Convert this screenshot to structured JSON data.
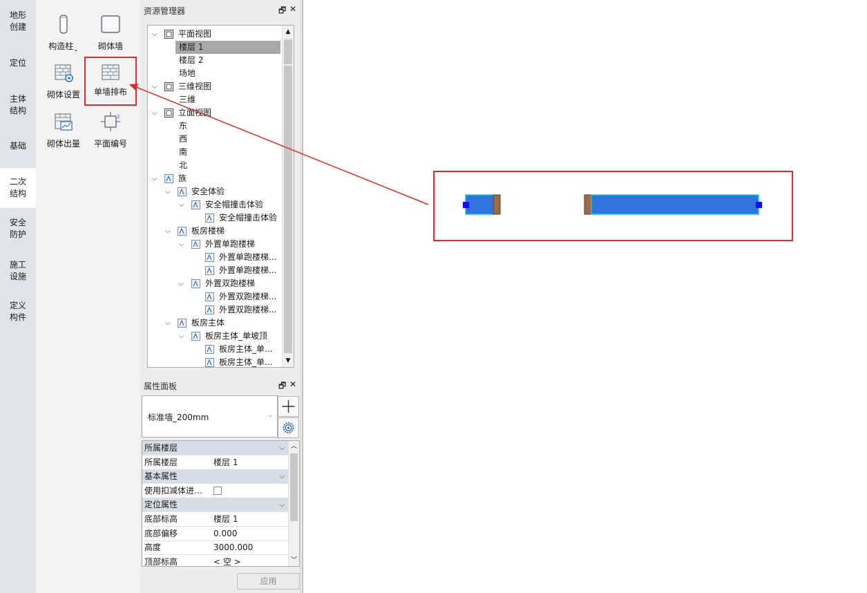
{
  "categories": [
    {
      "label": "地形\n创建",
      "active": false
    },
    {
      "label": "定位",
      "active": false
    },
    {
      "label": "主体\n结构",
      "active": false
    },
    {
      "label": "基础",
      "active": false
    },
    {
      "label": "二次\n结构",
      "active": true
    },
    {
      "label": "安全\n防护",
      "active": false
    },
    {
      "label": "施工\n设施",
      "active": false
    },
    {
      "label": "定义\n构件",
      "active": false
    }
  ],
  "tools": [
    {
      "label": "构造柱",
      "icon": "column-icon",
      "has_dropdown": true
    },
    {
      "label": "砌体墙",
      "icon": "wall-icon"
    },
    {
      "label": "砌体设置",
      "icon": "masonry-settings-icon"
    },
    {
      "label": "单墙排布",
      "icon": "single-wall-layout-icon",
      "highlighted": true
    },
    {
      "label": "砌体出量",
      "icon": "masonry-quantity-icon"
    },
    {
      "label": "平面编号",
      "icon": "plan-numbering-icon"
    }
  ],
  "resource_manager": {
    "title": "资源管理器",
    "tree": [
      {
        "label": "平面视图",
        "level": 0,
        "expanded": true,
        "icon": "plan-view-icon"
      },
      {
        "label": "楼层 1",
        "level": 1,
        "selected": true
      },
      {
        "label": "楼层 2",
        "level": 1
      },
      {
        "label": "场地",
        "level": 1
      },
      {
        "label": "三维视图",
        "level": 0,
        "expanded": true,
        "icon": "3d-view-icon"
      },
      {
        "label": "三维",
        "level": 1
      },
      {
        "label": "立面视图",
        "level": 0,
        "expanded": true,
        "icon": "elevation-view-icon"
      },
      {
        "label": "东",
        "level": 1
      },
      {
        "label": "西",
        "level": 1
      },
      {
        "label": "南",
        "level": 1
      },
      {
        "label": "北",
        "level": 1
      },
      {
        "label": "族",
        "level": 0,
        "expanded": true,
        "icon": "family-icon"
      },
      {
        "label": "安全体验",
        "level": 1,
        "expanded": true,
        "icon": "family-icon"
      },
      {
        "label": "安全帽撞击体验",
        "level": 2,
        "expanded": true,
        "icon": "family-icon"
      },
      {
        "label": "安全帽撞击体验",
        "level": 3,
        "icon": "family-icon"
      },
      {
        "label": "板房楼梯",
        "level": 1,
        "expanded": true,
        "icon": "family-icon"
      },
      {
        "label": "外置单跑楼梯",
        "level": 2,
        "expanded": true,
        "icon": "family-icon"
      },
      {
        "label": "外置单跑楼梯...",
        "level": 3,
        "icon": "family-icon"
      },
      {
        "label": "外置单跑楼梯...",
        "level": 3,
        "icon": "family-icon"
      },
      {
        "label": "外置双跑楼梯",
        "level": 2,
        "expanded": true,
        "icon": "family-icon"
      },
      {
        "label": "外置双跑楼梯...",
        "level": 3,
        "icon": "family-icon"
      },
      {
        "label": "外置双跑楼梯...",
        "level": 3,
        "icon": "family-icon"
      },
      {
        "label": "板房主体",
        "level": 1,
        "expanded": true,
        "icon": "family-icon"
      },
      {
        "label": "板房主体_单坡顶",
        "level": 2,
        "expanded": true,
        "icon": "family-icon"
      },
      {
        "label": "板房主体_单...",
        "level": 3,
        "icon": "family-icon"
      },
      {
        "label": "板房主体_单...",
        "level": 3,
        "icon": "family-icon"
      }
    ]
  },
  "properties": {
    "title": "属性面板",
    "type_name": "标准墙_200mm",
    "rows": [
      {
        "group": true,
        "label": "所属楼层"
      },
      {
        "label": "所属楼层",
        "value": "楼层 1"
      },
      {
        "group": true,
        "label": "基本属性"
      },
      {
        "label": "使用扣减体进…",
        "checkbox": true,
        "checked": false
      },
      {
        "group": true,
        "label": "定位属性"
      },
      {
        "label": "底部标高",
        "value": "楼层 1"
      },
      {
        "label": "底部偏移",
        "value": "0.000"
      },
      {
        "label": "高度",
        "value": "3000.000"
      },
      {
        "label": "顶部标高",
        "value": "< 空 >"
      }
    ],
    "apply_label": "应用"
  },
  "colors": {
    "accent_red": "#e32b2b",
    "wall_fill": "#2f74dc",
    "wall_outline": "#1fc7e6",
    "wall_end": "#9b6b47",
    "grip": "#1010ee",
    "selected_row": "#a8a8a8",
    "group_row": "#d7dde6"
  }
}
